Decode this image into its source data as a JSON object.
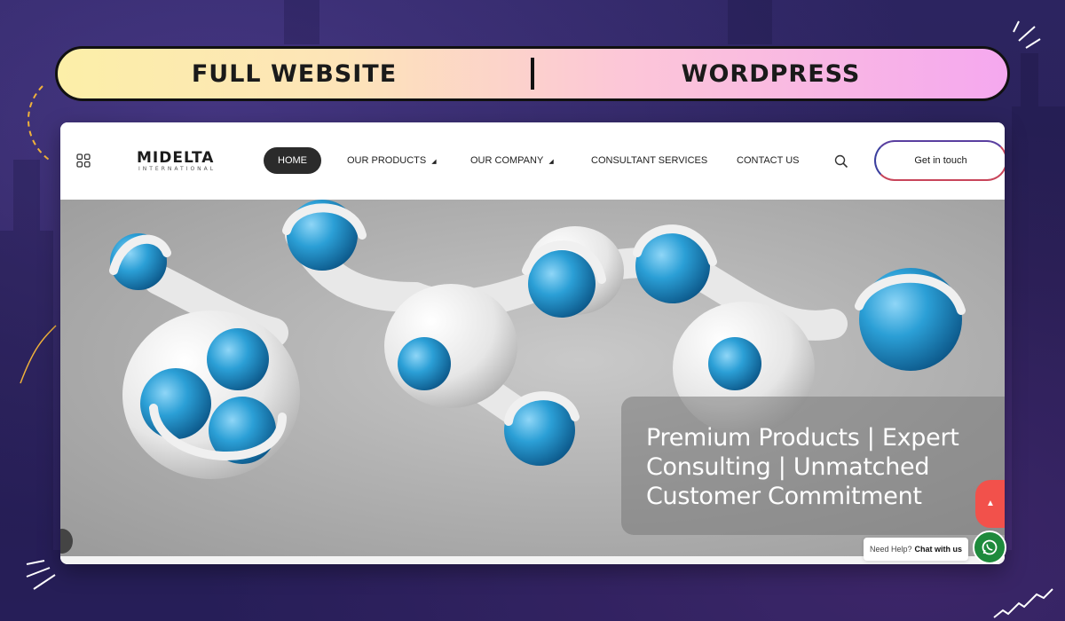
{
  "banner": {
    "left_label": "FULL WEBSITE",
    "right_label": "WORDPRESS"
  },
  "site": {
    "logo": {
      "name": "MIDELTA",
      "tagline": "INTERNATIONAL"
    },
    "nav": {
      "items": [
        {
          "label": "HOME",
          "active": true,
          "dropdown": false
        },
        {
          "label": "OUR PRODUCTS",
          "active": false,
          "dropdown": true
        },
        {
          "label": "OUR COMPANY",
          "active": false,
          "dropdown": true
        },
        {
          "label": "CONSULTANT SERVICES",
          "active": false,
          "dropdown": false
        },
        {
          "label": "CONTACT US",
          "active": false,
          "dropdown": false
        }
      ],
      "cta_label": "Get in touch",
      "icons": {
        "menu": "grid-icon",
        "search": "search-icon"
      }
    },
    "hero": {
      "headline_line1": "Premium Products | Expert",
      "headline_line2": "Consulting | Unmatched",
      "headline_line3": "Customer Commitment"
    },
    "chat": {
      "help_text": "Need Help?",
      "chat_label": "Chat with us",
      "icon": "whatsapp-icon"
    },
    "scroll_top_icon": "chevron-up-icon"
  },
  "colors": {
    "accent_red": "#f2514b",
    "accent_blue": "#2b9fd6",
    "whatsapp_green": "#1e8a3c",
    "nav_active_bg": "#2b2b2b"
  }
}
